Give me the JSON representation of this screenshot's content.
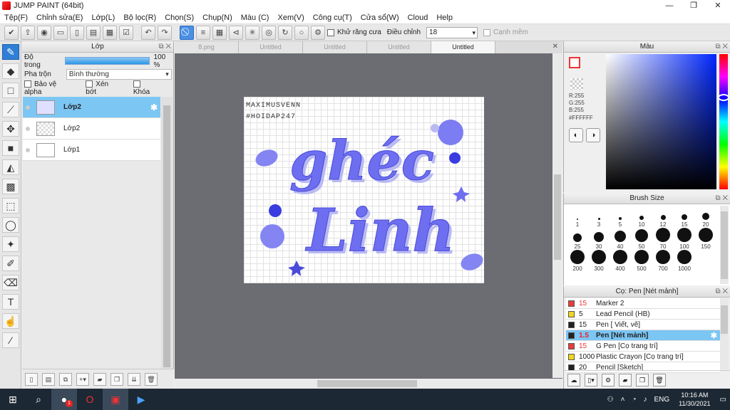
{
  "window": {
    "title": "JUMP PAINT (64bit)",
    "minimize": "—",
    "restore": "❐",
    "close": "✕"
  },
  "menu": [
    "Tệp(F)",
    "Chỉnh sửa(E)",
    "Lớp(L)",
    "Bộ lọc(R)",
    "Chọn(S)",
    "Chụp(N)",
    "Màu (C)",
    "Xem(V)",
    "Công cụ(T)",
    "Cửa sổ(W)",
    "Cloud",
    "Help"
  ],
  "toolbar": {
    "antialias_label": "Khử răng cưa",
    "adjust_label": "Điều chỉnh",
    "adjust_value": "18",
    "smooth_label": "Cạnh mềm"
  },
  "layer_panel": {
    "title": "Lớp",
    "opacity_label": "Độ trong",
    "opacity_value": "100 %",
    "opacity_fraction": 1.0,
    "blend_label": "Pha trộn",
    "blend_value": "Bình thường",
    "protect_alpha": "Bảo vệ alpha",
    "clip": "Xén bớt",
    "lock": "Khóa",
    "layers": [
      {
        "name": "Lớp2",
        "selected": true
      },
      {
        "name": "Lớp2",
        "selected": false
      },
      {
        "name": "Lớp1",
        "selected": false
      }
    ]
  },
  "tabs": [
    {
      "label": "8.png",
      "active": false
    },
    {
      "label": "Untitled",
      "active": false
    },
    {
      "label": "Untitled",
      "active": false
    },
    {
      "label": "Untitled",
      "active": false
    },
    {
      "label": "Untitled",
      "active": true
    }
  ],
  "artwork": {
    "line1": "MAXIMUSVENN",
    "line2": "#HOIDAP247",
    "word1": "ghéc",
    "word2": "Linh"
  },
  "color_panel": {
    "title": "Màu",
    "r": "R:255",
    "g": "G:255",
    "b": "B:255",
    "hex": "#FFFFFF"
  },
  "brush_panel": {
    "title": "Brush Size",
    "sizes": [
      "1",
      "3",
      "5",
      "10",
      "12",
      "15",
      "20",
      "25",
      "30",
      "40",
      "50",
      "70",
      "100",
      "150",
      "200",
      "300",
      "400",
      "500",
      "700",
      "1000"
    ]
  },
  "pen_panel": {
    "title": "Cọ: Pen [Nét mảnh]",
    "items": [
      {
        "size": "15",
        "name": "Marker 2",
        "color": "#e83c3c",
        "selected": false
      },
      {
        "size": "5",
        "name": "Lead Pencil (HB)",
        "color": "#f0d820",
        "selected": false
      },
      {
        "size": "15",
        "name": "Pen [ Viết, vẽ]",
        "color": "#222222",
        "selected": false
      },
      {
        "size": "1.5",
        "name": "Pen [Nét mảnh]",
        "color": "#222222",
        "selected": true
      },
      {
        "size": "15",
        "name": "G Pen [Cọ trang trí]",
        "color": "#e83c3c",
        "selected": false
      },
      {
        "size": "1000",
        "name": "Plastic Crayon [Cọ trang trí]",
        "color": "#f0d820",
        "selected": false
      },
      {
        "size": "20",
        "name": "Pencil [Sketch]",
        "color": "#222222",
        "selected": false
      }
    ]
  },
  "taskbar": {
    "lang": "ENG",
    "time": "10:16 AM",
    "date": "11/30/2021",
    "badge": "1"
  }
}
